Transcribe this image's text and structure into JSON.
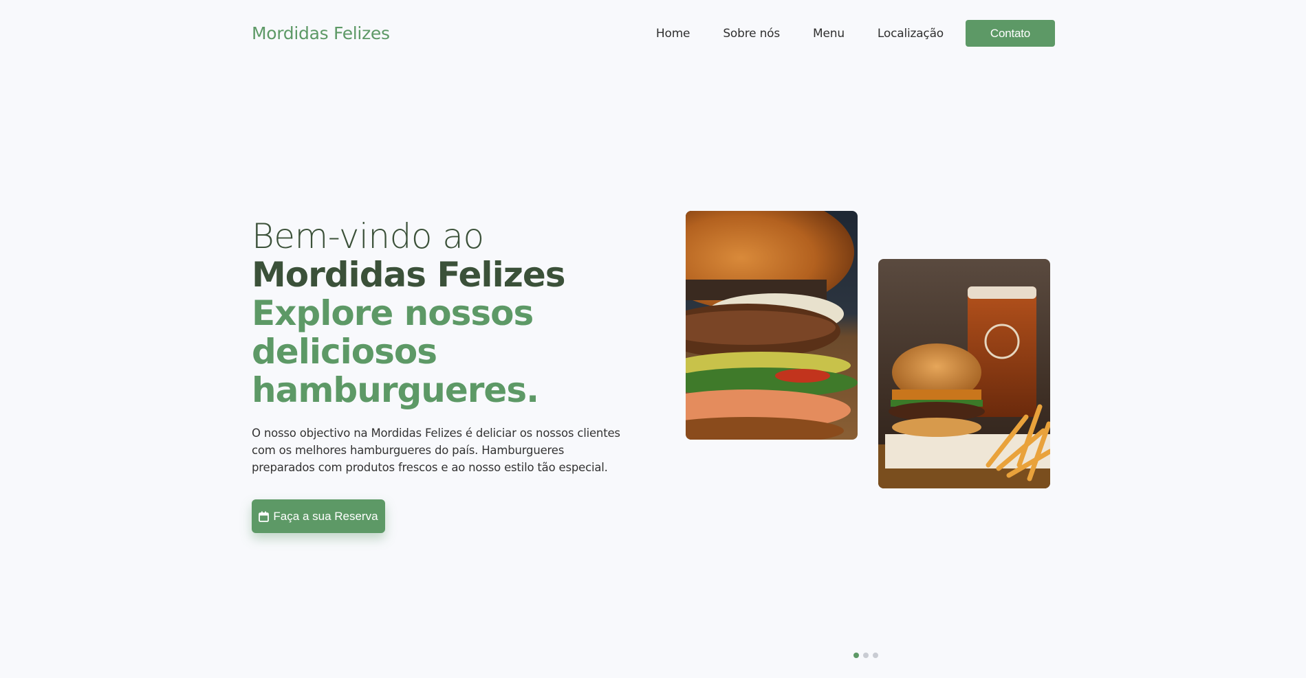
{
  "nav": {
    "brand": "Mordidas Felizes",
    "links": [
      "Home",
      "Sobre nós",
      "Menu",
      "Localização"
    ],
    "contact_label": "Contato"
  },
  "hero": {
    "line1": "Bem-vindo ao",
    "line2": "Mordidas Felizes",
    "line3": "Explore nossos deliciosos hamburgueres.",
    "description": "O nosso objectivo na Mordidas Felizes é deliciar os nossos clientes com os melhores hamburgueres do país. Hamburgueres preparados com produtos frescos e ao nosso estilo tão especial.",
    "reserve_label": "Faça a sua Reserva",
    "reserve_icon": "calendar-icon"
  },
  "gallery": {
    "images": [
      "burger-photo",
      "burger-fries-beer-photo"
    ]
  },
  "carousel": {
    "active_index": 0,
    "total": 3
  },
  "colors": {
    "accent": "#5d9966",
    "heading_dark": "#3b5139",
    "background": "#f8f9fc"
  }
}
